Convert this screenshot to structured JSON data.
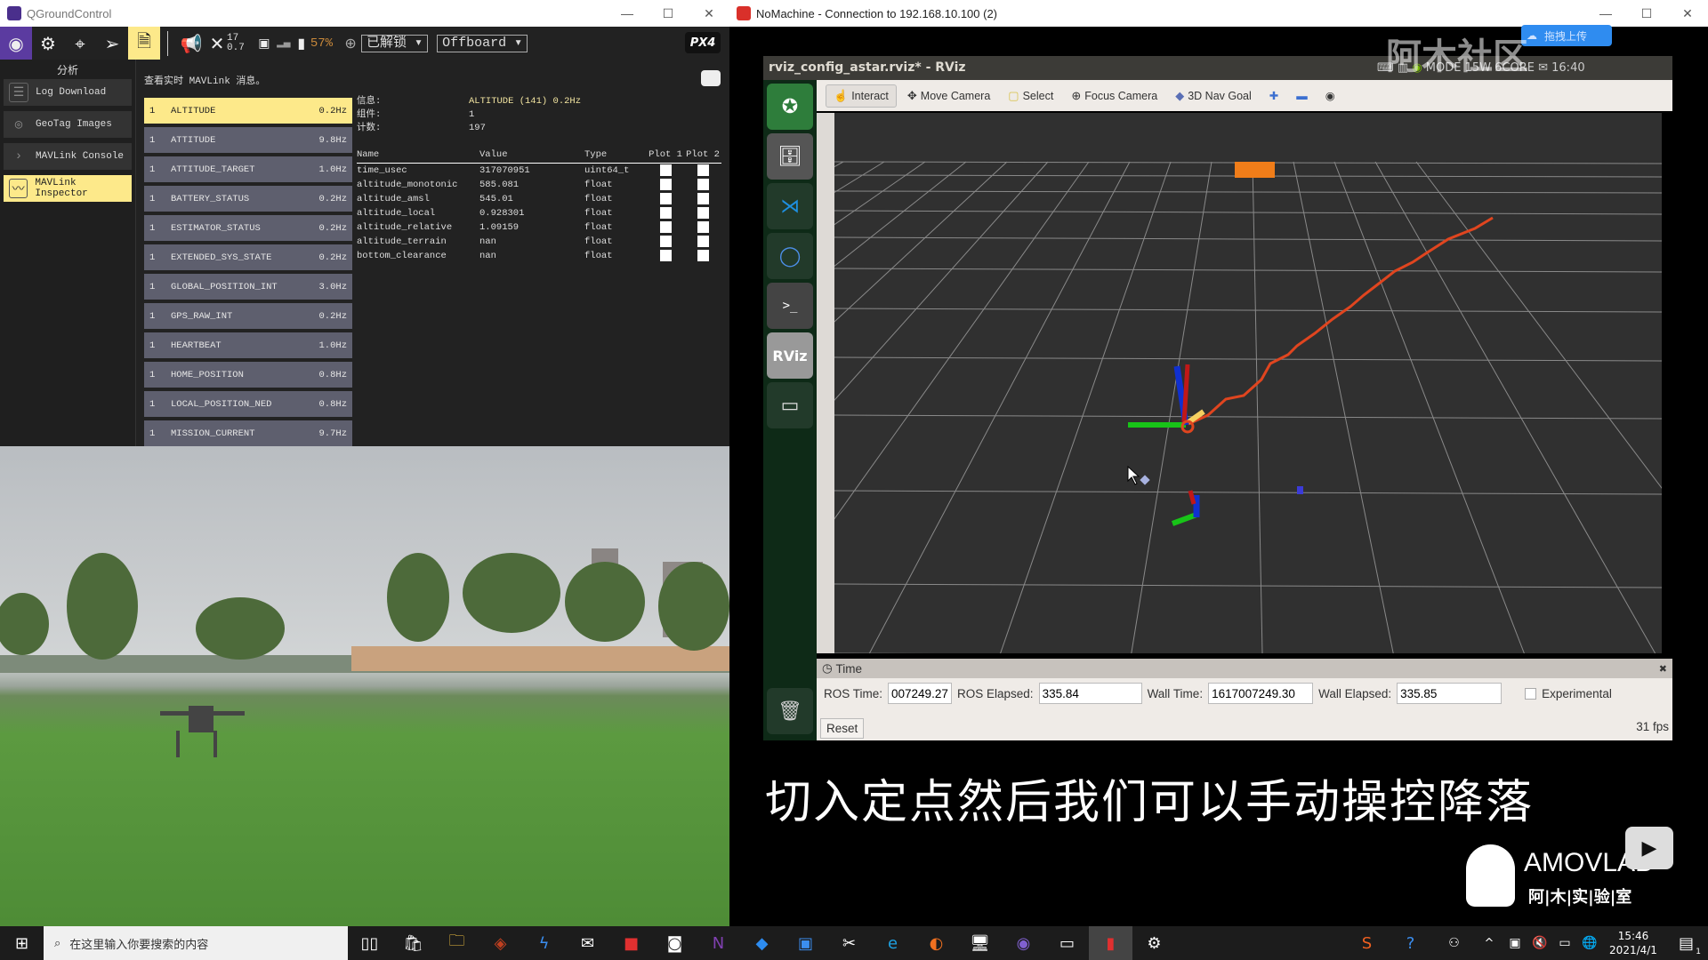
{
  "qgc": {
    "window_title": "QGroundControl",
    "toolbar": {
      "icons": [
        "qgc-logo-icon",
        "settings-icon",
        "plan-icon",
        "fly-icon",
        "analyze-icon"
      ],
      "satellite_count": "17",
      "hdop": "0.7",
      "battery": "57%",
      "arm_state": "已解锁",
      "flight_mode": "Offboard",
      "brand": "PX4"
    },
    "sidebar": {
      "title": "分析",
      "items": [
        {
          "label": "Log Download",
          "icon": "list-icon"
        },
        {
          "label": "GeoTag Images",
          "icon": "map-pin-icon"
        },
        {
          "label": "MAVLink Console",
          "icon": "chevron-right-icon"
        },
        {
          "label": "MAVLink Inspector",
          "icon": "chart-search-icon",
          "active": true
        }
      ]
    },
    "inspector": {
      "description": "查看实时 MAVLink 消息。",
      "messages": [
        {
          "comp": "1",
          "name": "ALTITUDE",
          "rate": "0.2Hz",
          "selected": true
        },
        {
          "comp": "1",
          "name": "ATTITUDE",
          "rate": "9.8Hz"
        },
        {
          "comp": "1",
          "name": "ATTITUDE_TARGET",
          "rate": "1.0Hz"
        },
        {
          "comp": "1",
          "name": "BATTERY_STATUS",
          "rate": "0.2Hz"
        },
        {
          "comp": "1",
          "name": "ESTIMATOR_STATUS",
          "rate": "0.2Hz"
        },
        {
          "comp": "1",
          "name": "EXTENDED_SYS_STATE",
          "rate": "0.2Hz"
        },
        {
          "comp": "1",
          "name": "GLOBAL_POSITION_INT",
          "rate": "3.0Hz"
        },
        {
          "comp": "1",
          "name": "GPS_RAW_INT",
          "rate": "0.2Hz"
        },
        {
          "comp": "1",
          "name": "HEARTBEAT",
          "rate": "1.0Hz"
        },
        {
          "comp": "1",
          "name": "HOME_POSITION",
          "rate": "0.8Hz"
        },
        {
          "comp": "1",
          "name": "LOCAL_POSITION_NED",
          "rate": "0.8Hz"
        },
        {
          "comp": "1",
          "name": "MISSION_CURRENT",
          "rate": "9.7Hz"
        }
      ],
      "detail": {
        "message_label": "信息:",
        "message_value": "ALTITUDE (141) 0.2Hz",
        "component_label": "组件:",
        "component_value": "1",
        "count_label": "计数:",
        "count_value": "197",
        "columns": [
          "Name",
          "Value",
          "Type",
          "Plot 1",
          "Plot 2"
        ],
        "fields": [
          {
            "name": "time_usec",
            "value": "317070951",
            "type": "uint64_t"
          },
          {
            "name": "altitude_monotonic",
            "value": "585.081",
            "type": "float"
          },
          {
            "name": "altitude_amsl",
            "value": "545.01",
            "type": "float"
          },
          {
            "name": "altitude_local",
            "value": "0.928301",
            "type": "float"
          },
          {
            "name": "altitude_relative",
            "value": "1.09159",
            "type": "float"
          },
          {
            "name": "altitude_terrain",
            "value": "nan",
            "type": "float"
          },
          {
            "name": "bottom_clearance",
            "value": "nan",
            "type": "float"
          }
        ]
      }
    }
  },
  "nomachine": {
    "window_title": "NoMachine - Connection to 192.168.10.100 (2)",
    "upload_badge": "拖拽上传",
    "rviz": {
      "title": "rviz_config_astar.rviz* - RViz",
      "status_text": "MODE 15W 6CORE",
      "clock": "16:40",
      "tools": [
        "Interact",
        "Move Camera",
        "Select",
        "Focus Camera",
        "3D Nav Goal"
      ],
      "launcher": [
        "ubuntu-icon",
        "files-icon",
        "vscode-icon",
        "chromium-icon",
        "terminal-icon",
        "rviz-icon",
        "drive-icon",
        "trash-icon"
      ],
      "time_panel": {
        "title": "Time",
        "ros_time_label": "ROS Time:",
        "ros_time": "007249.27",
        "ros_elapsed_label": "ROS Elapsed:",
        "ros_elapsed": "335.84",
        "wall_time_label": "Wall Time:",
        "wall_time": "1617007249.30",
        "wall_elapsed_label": "Wall Elapsed:",
        "wall_elapsed": "335.85",
        "experimental_label": "Experimental",
        "reset_label": "Reset",
        "fps": "31 fps"
      }
    }
  },
  "overlay": {
    "subtitle": "切入定点然后我们可以手动操控降落",
    "watermark": "阿木社区",
    "logo_text": "AMOVLAB",
    "logo_sub": "阿|木|实|验|室"
  },
  "taskbar": {
    "search_placeholder": "在这里输入你要搜索的内容",
    "time": "15:46",
    "date": "2021/4/1",
    "notification_count": "1"
  }
}
